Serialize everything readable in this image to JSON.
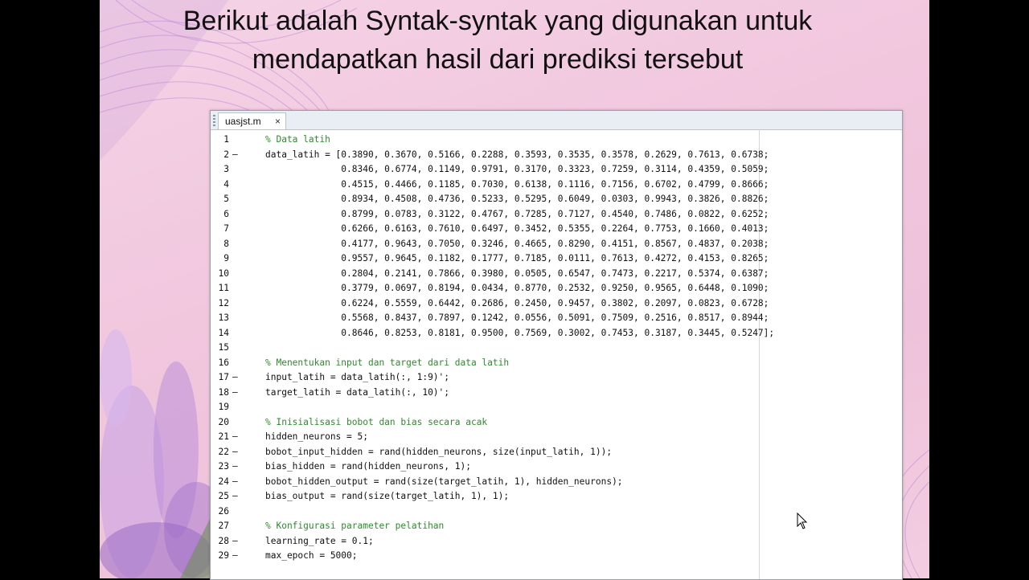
{
  "slide_title_line1": "Berikut adalah Syntak-syntak yang digunakan untuk",
  "slide_title_line2": "mendapatkan hasil dari prediksi tersebut",
  "editor": {
    "tab_name": "uasjst.m",
    "close_glyph": "×",
    "lines": [
      {
        "n": "1",
        "m": "",
        "t": "% Data latih",
        "c": true
      },
      {
        "n": "2",
        "m": "–",
        "t": "data_latih = [0.3890, 0.3670, 0.5166, 0.2288, 0.3593, 0.3535, 0.3578, 0.2629, 0.7613, 0.6738;",
        "c": false
      },
      {
        "n": "3",
        "m": "",
        "t": "              0.8346, 0.6774, 0.1149, 0.9791, 0.3170, 0.3323, 0.7259, 0.3114, 0.4359, 0.5059;",
        "c": false
      },
      {
        "n": "4",
        "m": "",
        "t": "              0.4515, 0.4466, 0.1185, 0.7030, 0.6138, 0.1116, 0.7156, 0.6702, 0.4799, 0.8666;",
        "c": false
      },
      {
        "n": "5",
        "m": "",
        "t": "              0.8934, 0.4508, 0.4736, 0.5233, 0.5295, 0.6049, 0.0303, 0.9943, 0.3826, 0.8826;",
        "c": false
      },
      {
        "n": "6",
        "m": "",
        "t": "              0.8799, 0.0783, 0.3122, 0.4767, 0.7285, 0.7127, 0.4540, 0.7486, 0.0822, 0.6252;",
        "c": false
      },
      {
        "n": "7",
        "m": "",
        "t": "              0.6266, 0.6163, 0.7610, 0.6497, 0.3452, 0.5355, 0.2264, 0.7753, 0.1660, 0.4013;",
        "c": false
      },
      {
        "n": "8",
        "m": "",
        "t": "              0.4177, 0.9643, 0.7050, 0.3246, 0.4665, 0.8290, 0.4151, 0.8567, 0.4837, 0.2038;",
        "c": false
      },
      {
        "n": "9",
        "m": "",
        "t": "              0.9557, 0.9645, 0.1182, 0.1777, 0.7185, 0.0111, 0.7613, 0.4272, 0.4153, 0.8265;",
        "c": false
      },
      {
        "n": "10",
        "m": "",
        "t": "              0.2804, 0.2141, 0.7866, 0.3980, 0.0505, 0.6547, 0.7473, 0.2217, 0.5374, 0.6387;",
        "c": false
      },
      {
        "n": "11",
        "m": "",
        "t": "              0.3779, 0.0697, 0.8194, 0.0434, 0.8770, 0.2532, 0.9250, 0.9565, 0.6448, 0.1090;",
        "c": false
      },
      {
        "n": "12",
        "m": "",
        "t": "              0.6224, 0.5559, 0.6442, 0.2686, 0.2450, 0.9457, 0.3802, 0.2097, 0.0823, 0.6728;",
        "c": false
      },
      {
        "n": "13",
        "m": "",
        "t": "              0.5568, 0.8437, 0.7897, 0.1242, 0.0556, 0.5091, 0.7509, 0.2516, 0.8517, 0.8944;",
        "c": false
      },
      {
        "n": "14",
        "m": "",
        "t": "              0.8646, 0.8253, 0.8181, 0.9500, 0.7569, 0.3002, 0.7453, 0.3187, 0.3445, 0.5247];",
        "c": false
      },
      {
        "n": "15",
        "m": "",
        "t": "",
        "c": false
      },
      {
        "n": "16",
        "m": "",
        "t": "% Menentukan input dan target dari data latih",
        "c": true
      },
      {
        "n": "17",
        "m": "–",
        "t": "input_latih = data_latih(:, 1:9)';",
        "c": false
      },
      {
        "n": "18",
        "m": "–",
        "t": "target_latih = data_latih(:, 10)';",
        "c": false
      },
      {
        "n": "19",
        "m": "",
        "t": "",
        "c": false
      },
      {
        "n": "20",
        "m": "",
        "t": "% Inisialisasi bobot dan bias secara acak",
        "c": true
      },
      {
        "n": "21",
        "m": "–",
        "t": "hidden_neurons = 5;",
        "c": false
      },
      {
        "n": "22",
        "m": "–",
        "t": "bobot_input_hidden = rand(hidden_neurons, size(input_latih, 1));",
        "c": false
      },
      {
        "n": "23",
        "m": "–",
        "t": "bias_hidden = rand(hidden_neurons, 1);",
        "c": false
      },
      {
        "n": "24",
        "m": "–",
        "t": "bobot_hidden_output = rand(size(target_latih, 1), hidden_neurons);",
        "c": false
      },
      {
        "n": "25",
        "m": "–",
        "t": "bias_output = rand(size(target_latih, 1), 1);",
        "c": false
      },
      {
        "n": "26",
        "m": "",
        "t": "",
        "c": false
      },
      {
        "n": "27",
        "m": "",
        "t": "% Konfigurasi parameter pelatihan",
        "c": true
      },
      {
        "n": "28",
        "m": "–",
        "t": "learning_rate = 0.1;",
        "c": false
      },
      {
        "n": "29",
        "m": "–",
        "t": "max_epoch = 5000;",
        "c": false
      }
    ]
  },
  "colors": {
    "comment": "#2f8a2f",
    "slide_bg": "#f2c9df",
    "accent_purple": "#9b5fc8"
  }
}
